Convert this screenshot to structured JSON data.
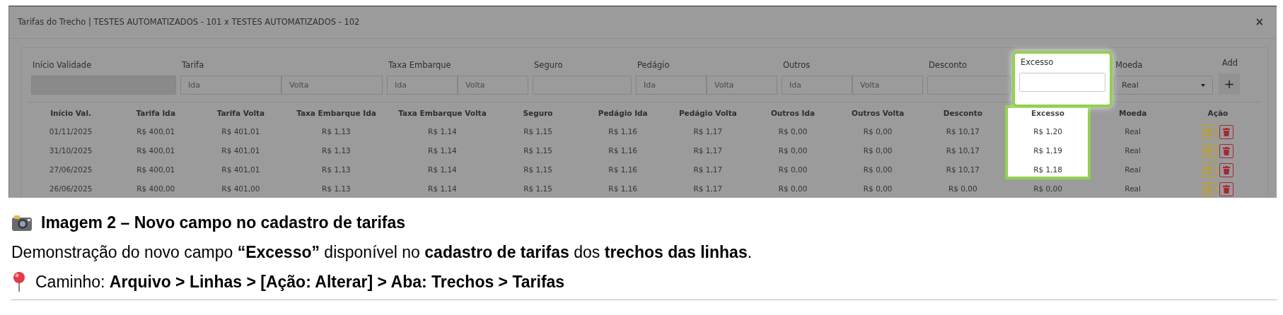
{
  "screenshot": {
    "title": "Tarifas do Trecho | TESTES AUTOMATIZADOS - 101 x TESTES AUTOMATIZADOS - 102",
    "close": "×",
    "form": [
      {
        "kind": "single",
        "label": "Início Validade",
        "disabled": true,
        "highlighted": false
      },
      {
        "kind": "pair",
        "label": "Tarifa",
        "placeholders": [
          "Ida",
          "Volta"
        ],
        "disabled": false,
        "highlighted": false
      },
      {
        "kind": "pair",
        "label": "Taxa Embarque",
        "placeholders": [
          "Ida",
          "Volta"
        ],
        "disabled": false,
        "highlighted": false
      },
      {
        "kind": "single",
        "label": "Seguro",
        "disabled": false,
        "highlighted": false
      },
      {
        "kind": "pair",
        "label": "Pedágio",
        "placeholders": [
          "Ida",
          "Volta"
        ],
        "disabled": false,
        "highlighted": false
      },
      {
        "kind": "pair",
        "label": "Outros",
        "placeholders": [
          "Ida",
          "Volta"
        ],
        "disabled": false,
        "highlighted": false
      },
      {
        "kind": "single",
        "label": "Desconto",
        "disabled": false,
        "highlighted": false
      },
      {
        "kind": "single",
        "label": "Excesso",
        "disabled": false,
        "highlighted": true
      },
      {
        "kind": "select",
        "label": "Moeda",
        "value": "Real",
        "disabled": false,
        "highlighted": false
      },
      {
        "kind": "add",
        "label": "Add",
        "button": "+",
        "disabled": false,
        "highlighted": false
      }
    ],
    "table": {
      "columns": [
        {
          "label": "Início Val.",
          "highlighted": false
        },
        {
          "label": "Tarifa Ida",
          "highlighted": false
        },
        {
          "label": "Tarifa Volta",
          "highlighted": false
        },
        {
          "label": "Taxa Embarque Ida",
          "highlighted": false
        },
        {
          "label": "Taxa Embarque Volta",
          "highlighted": false
        },
        {
          "label": "Seguro",
          "highlighted": false
        },
        {
          "label": "Pedágio Ida",
          "highlighted": false
        },
        {
          "label": "Pedágio Volta",
          "highlighted": false
        },
        {
          "label": "Outros Ida",
          "highlighted": false
        },
        {
          "label": "Outros Volta",
          "highlighted": false
        },
        {
          "label": "Desconto",
          "highlighted": false
        },
        {
          "label": "Excesso",
          "highlighted": true
        },
        {
          "label": "Moeda",
          "highlighted": false
        },
        {
          "label": "Ação",
          "highlighted": false
        }
      ],
      "rows": [
        {
          "cells": [
            "01/11/2025",
            "R$ 400,01",
            "R$ 401,01",
            "R$ 1,13",
            "R$ 1,14",
            "R$ 1,15",
            "R$ 1,16",
            "R$ 1,17",
            "R$ 0,00",
            "R$ 0,00",
            "R$ 10,17",
            "R$ 1,20",
            "Real"
          ],
          "excess_highlighted": true
        },
        {
          "cells": [
            "31/10/2025",
            "R$ 400,01",
            "R$ 401,01",
            "R$ 1,13",
            "R$ 1,14",
            "R$ 1,15",
            "R$ 1,16",
            "R$ 1,17",
            "R$ 0,00",
            "R$ 0,00",
            "R$ 10,17",
            "R$ 1,19",
            "Real"
          ],
          "excess_highlighted": true
        },
        {
          "cells": [
            "27/06/2025",
            "R$ 400,01",
            "R$ 401,01",
            "R$ 1,13",
            "R$ 1,14",
            "R$ 1,15",
            "R$ 1,16",
            "R$ 1,17",
            "R$ 0,00",
            "R$ 0,00",
            "R$ 10,17",
            "R$ 1,18",
            "Real"
          ],
          "excess_highlighted": true
        },
        {
          "cells": [
            "26/06/2025",
            "R$ 400,00",
            "R$ 401,00",
            "R$ 1,13",
            "R$ 1,14",
            "R$ 1,15",
            "R$ 1,16",
            "R$ 1,17",
            "R$ 0,00",
            "R$ 0,00",
            "R$ 0,00",
            "R$ 0,00",
            "Real"
          ],
          "excess_highlighted": false
        }
      ]
    }
  },
  "caption": {
    "title": "Imagem 2 – Novo campo no cadastro de tarifas",
    "description": "Demonstração do novo campo **“Excesso”** disponível no **cadastro de tarifas** dos **trechos das linhas**.",
    "path": "Caminho: **Arquivo > Linhas > [Ação: Alterar] > Aba: Trechos > Tarifas**"
  }
}
